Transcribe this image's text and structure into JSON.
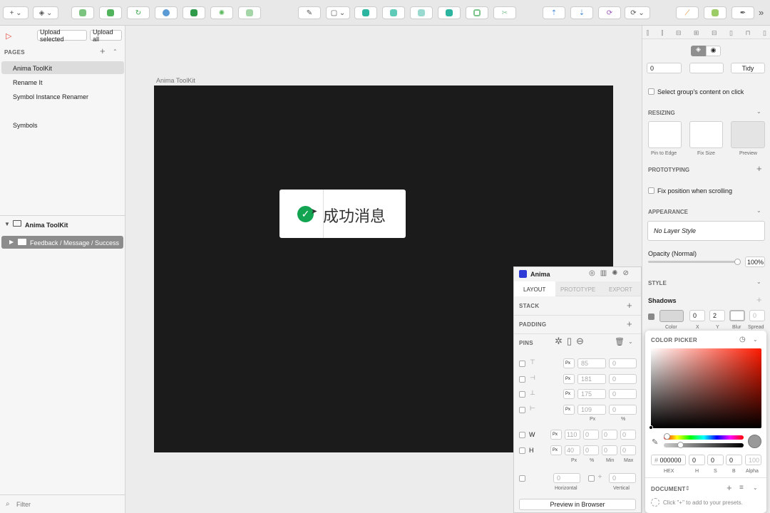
{
  "toolbar": {
    "more": "»"
  },
  "left": {
    "upload_selected": "Upload selected",
    "upload_all": "Upload all",
    "pages_header": "PAGES",
    "pages": [
      "Anima ToolKit",
      "Rename It",
      "Symbol Instance Renamer",
      "Symbols"
    ],
    "layer_page": "Anima ToolKit",
    "layer_item": "Feedback / Message / Success",
    "filter": "Filter"
  },
  "canvas": {
    "artboard_label": "Anima ToolKit",
    "toast_text": "成功消息"
  },
  "right": {
    "spacing_value": "0",
    "tidy": "Tidy",
    "select_group": "Select group's content on click",
    "resizing": "RESIZING",
    "pin_to_edge": "Pin to Edge",
    "fix_size": "Fix Size",
    "preview": "Preview",
    "prototyping": "PROTOTYPING",
    "fix_position": "Fix position when scrolling",
    "appearance": "APPEARANCE",
    "layer_style": "No Layer Style",
    "opacity_label": "Opacity (Normal)",
    "opacity_value": "100%",
    "opacity": 1.0,
    "style": "STYLE",
    "shadows": "Shadows",
    "shadow": {
      "x": "0",
      "y": "2",
      "spread": "0",
      "lbl_color": "Color",
      "lbl_x": "X",
      "lbl_y": "Y",
      "lbl_blur": "Blur",
      "lbl_spread": "Spread"
    }
  },
  "anima": {
    "title": "Anima",
    "tabs": [
      "LAYOUT",
      "PROTOTYPE",
      "EXPORT"
    ],
    "stack": "STACK",
    "padding": "PADDING",
    "pins": "PINS",
    "px": "Px",
    "pins_values": [
      [
        "85",
        "0"
      ],
      [
        "181",
        "0"
      ],
      [
        "175",
        "0"
      ],
      [
        "109",
        "0"
      ]
    ],
    "col_px": "Px",
    "col_pct": "%",
    "w": "W",
    "h": "H",
    "w_values": [
      "110",
      "0",
      "0",
      "0"
    ],
    "h_values": [
      "40",
      "0",
      "0",
      "0"
    ],
    "size_cols": [
      "Px",
      "%",
      "Min",
      "Max"
    ],
    "horizontal_value": "0",
    "vertical_value": "0",
    "horizontal": "Horizontal",
    "vertical": "Vertical",
    "preview_button": "Preview in Browser"
  },
  "picker": {
    "title": "COLOR PICKER",
    "hex": "000000",
    "h": "0",
    "s": "0",
    "b": "0",
    "alpha": "100",
    "lbl_hex": "HEX",
    "lbl_h": "H",
    "lbl_s": "S",
    "lbl_b": "B",
    "lbl_alpha": "Alpha",
    "document": "DOCUMENT",
    "hint": "Click \"+\" to add to your presets."
  },
  "colors": {
    "accent": "#2f9a4a",
    "canvas": "#1b1b1b",
    "toast_check": "#13a452"
  }
}
